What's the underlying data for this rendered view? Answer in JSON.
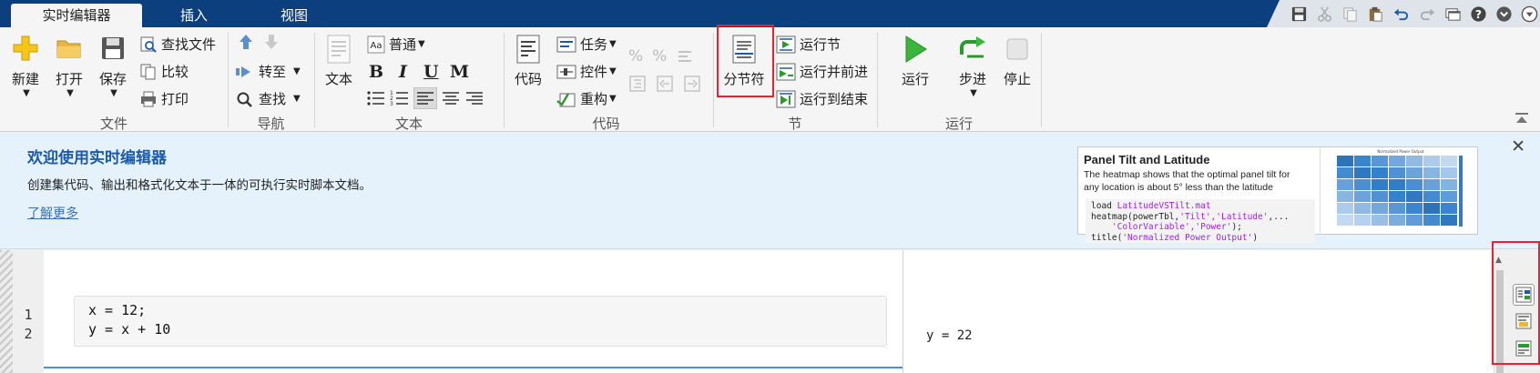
{
  "tabs": [
    {
      "label": "实时编辑器",
      "active": true
    },
    {
      "label": "插入",
      "active": false
    },
    {
      "label": "视图",
      "active": false
    }
  ],
  "ribbon": {
    "file": {
      "label": "文件",
      "new": "新建",
      "open": "打开",
      "save": "保存",
      "find_files": "查找文件",
      "compare": "比较",
      "print": "打印"
    },
    "navigate": {
      "label": "导航",
      "goto": "转至",
      "find": "查找"
    },
    "text": {
      "label": "文本",
      "text_btn": "文本",
      "style": "普通",
      "bold": "B",
      "italic": "I",
      "underline": "U",
      "mono": "M"
    },
    "code": {
      "label": "代码",
      "code_btn": "代码",
      "task": "任务",
      "control": "控件",
      "refactor": "重构"
    },
    "section": {
      "label": "节",
      "section_break": "分节符",
      "run_section": "运行节",
      "run_advance": "运行并前进",
      "run_to_end": "运行到结束"
    },
    "run": {
      "label": "运行",
      "run": "运行",
      "step": "步进",
      "stop": "停止"
    }
  },
  "welcome": {
    "title": "欢迎使用实时编辑器",
    "description": "创建集代码、输出和格式化文本于一体的可执行实时脚本文档。",
    "learn_more": "了解更多",
    "card": {
      "title": "Panel Tilt and Latitude",
      "description": "The heatmap shows that the optimal panel tilt for any location is about 5° less than the latitude",
      "code": [
        {
          "plain": "load ",
          "str": "LatitudeVSTilt.mat",
          "rest": ""
        },
        {
          "plain": "heatmap(powerTbl,",
          "str": "'Tilt','Latitude'",
          "rest": ",..."
        },
        {
          "plain": "    ",
          "str": "'ColorVariable','Power'",
          "rest": ");"
        },
        {
          "plain": "title(",
          "str": "'Normalized Power Output'",
          "rest": ")"
        }
      ],
      "heatmap_title": "Normalized Power Output"
    }
  },
  "editor": {
    "line_numbers": [
      "1",
      "2"
    ],
    "code_lines": [
      "x = 12;",
      "y = x + 10"
    ],
    "output": "y = 22"
  },
  "colors": {
    "tabbar": "#0b3f7e",
    "accent": "#1a5aa8",
    "highlight": "#e8232f"
  }
}
